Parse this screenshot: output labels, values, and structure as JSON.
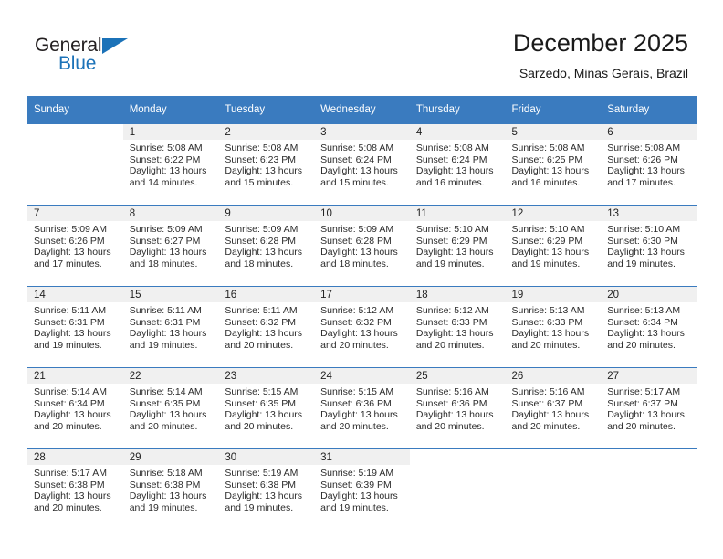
{
  "brand": {
    "line1": "General",
    "line2": "Blue",
    "triangle_icon": "triangle-icon",
    "color_dark": "#231f20",
    "color_blue": "#1b72b8"
  },
  "header": {
    "title": "December 2025",
    "subtitle": "Sarzedo, Minas Gerais, Brazil"
  },
  "theme": {
    "header_bar": "#3a7bbf",
    "day_band": "#f0f0f0",
    "text": "#2b2b2b"
  },
  "weekday_headers": [
    "Sunday",
    "Monday",
    "Tuesday",
    "Wednesday",
    "Thursday",
    "Friday",
    "Saturday"
  ],
  "weeks": [
    [
      {
        "day": "",
        "sunrise": "",
        "sunset": "",
        "daylight": "",
        "daylight2": "",
        "blank": true
      },
      {
        "day": "1",
        "sunrise": "Sunrise: 5:08 AM",
        "sunset": "Sunset: 6:22 PM",
        "daylight": "Daylight: 13 hours",
        "daylight2": "and 14 minutes."
      },
      {
        "day": "2",
        "sunrise": "Sunrise: 5:08 AM",
        "sunset": "Sunset: 6:23 PM",
        "daylight": "Daylight: 13 hours",
        "daylight2": "and 15 minutes."
      },
      {
        "day": "3",
        "sunrise": "Sunrise: 5:08 AM",
        "sunset": "Sunset: 6:24 PM",
        "daylight": "Daylight: 13 hours",
        "daylight2": "and 15 minutes."
      },
      {
        "day": "4",
        "sunrise": "Sunrise: 5:08 AM",
        "sunset": "Sunset: 6:24 PM",
        "daylight": "Daylight: 13 hours",
        "daylight2": "and 16 minutes."
      },
      {
        "day": "5",
        "sunrise": "Sunrise: 5:08 AM",
        "sunset": "Sunset: 6:25 PM",
        "daylight": "Daylight: 13 hours",
        "daylight2": "and 16 minutes."
      },
      {
        "day": "6",
        "sunrise": "Sunrise: 5:08 AM",
        "sunset": "Sunset: 6:26 PM",
        "daylight": "Daylight: 13 hours",
        "daylight2": "and 17 minutes."
      }
    ],
    [
      {
        "day": "7",
        "sunrise": "Sunrise: 5:09 AM",
        "sunset": "Sunset: 6:26 PM",
        "daylight": "Daylight: 13 hours",
        "daylight2": "and 17 minutes."
      },
      {
        "day": "8",
        "sunrise": "Sunrise: 5:09 AM",
        "sunset": "Sunset: 6:27 PM",
        "daylight": "Daylight: 13 hours",
        "daylight2": "and 18 minutes."
      },
      {
        "day": "9",
        "sunrise": "Sunrise: 5:09 AM",
        "sunset": "Sunset: 6:28 PM",
        "daylight": "Daylight: 13 hours",
        "daylight2": "and 18 minutes."
      },
      {
        "day": "10",
        "sunrise": "Sunrise: 5:09 AM",
        "sunset": "Sunset: 6:28 PM",
        "daylight": "Daylight: 13 hours",
        "daylight2": "and 18 minutes."
      },
      {
        "day": "11",
        "sunrise": "Sunrise: 5:10 AM",
        "sunset": "Sunset: 6:29 PM",
        "daylight": "Daylight: 13 hours",
        "daylight2": "and 19 minutes."
      },
      {
        "day": "12",
        "sunrise": "Sunrise: 5:10 AM",
        "sunset": "Sunset: 6:29 PM",
        "daylight": "Daylight: 13 hours",
        "daylight2": "and 19 minutes."
      },
      {
        "day": "13",
        "sunrise": "Sunrise: 5:10 AM",
        "sunset": "Sunset: 6:30 PM",
        "daylight": "Daylight: 13 hours",
        "daylight2": "and 19 minutes."
      }
    ],
    [
      {
        "day": "14",
        "sunrise": "Sunrise: 5:11 AM",
        "sunset": "Sunset: 6:31 PM",
        "daylight": "Daylight: 13 hours",
        "daylight2": "and 19 minutes."
      },
      {
        "day": "15",
        "sunrise": "Sunrise: 5:11 AM",
        "sunset": "Sunset: 6:31 PM",
        "daylight": "Daylight: 13 hours",
        "daylight2": "and 19 minutes."
      },
      {
        "day": "16",
        "sunrise": "Sunrise: 5:11 AM",
        "sunset": "Sunset: 6:32 PM",
        "daylight": "Daylight: 13 hours",
        "daylight2": "and 20 minutes."
      },
      {
        "day": "17",
        "sunrise": "Sunrise: 5:12 AM",
        "sunset": "Sunset: 6:32 PM",
        "daylight": "Daylight: 13 hours",
        "daylight2": "and 20 minutes."
      },
      {
        "day": "18",
        "sunrise": "Sunrise: 5:12 AM",
        "sunset": "Sunset: 6:33 PM",
        "daylight": "Daylight: 13 hours",
        "daylight2": "and 20 minutes."
      },
      {
        "day": "19",
        "sunrise": "Sunrise: 5:13 AM",
        "sunset": "Sunset: 6:33 PM",
        "daylight": "Daylight: 13 hours",
        "daylight2": "and 20 minutes."
      },
      {
        "day": "20",
        "sunrise": "Sunrise: 5:13 AM",
        "sunset": "Sunset: 6:34 PM",
        "daylight": "Daylight: 13 hours",
        "daylight2": "and 20 minutes."
      }
    ],
    [
      {
        "day": "21",
        "sunrise": "Sunrise: 5:14 AM",
        "sunset": "Sunset: 6:34 PM",
        "daylight": "Daylight: 13 hours",
        "daylight2": "and 20 minutes."
      },
      {
        "day": "22",
        "sunrise": "Sunrise: 5:14 AM",
        "sunset": "Sunset: 6:35 PM",
        "daylight": "Daylight: 13 hours",
        "daylight2": "and 20 minutes."
      },
      {
        "day": "23",
        "sunrise": "Sunrise: 5:15 AM",
        "sunset": "Sunset: 6:35 PM",
        "daylight": "Daylight: 13 hours",
        "daylight2": "and 20 minutes."
      },
      {
        "day": "24",
        "sunrise": "Sunrise: 5:15 AM",
        "sunset": "Sunset: 6:36 PM",
        "daylight": "Daylight: 13 hours",
        "daylight2": "and 20 minutes."
      },
      {
        "day": "25",
        "sunrise": "Sunrise: 5:16 AM",
        "sunset": "Sunset: 6:36 PM",
        "daylight": "Daylight: 13 hours",
        "daylight2": "and 20 minutes."
      },
      {
        "day": "26",
        "sunrise": "Sunrise: 5:16 AM",
        "sunset": "Sunset: 6:37 PM",
        "daylight": "Daylight: 13 hours",
        "daylight2": "and 20 minutes."
      },
      {
        "day": "27",
        "sunrise": "Sunrise: 5:17 AM",
        "sunset": "Sunset: 6:37 PM",
        "daylight": "Daylight: 13 hours",
        "daylight2": "and 20 minutes."
      }
    ],
    [
      {
        "day": "28",
        "sunrise": "Sunrise: 5:17 AM",
        "sunset": "Sunset: 6:38 PM",
        "daylight": "Daylight: 13 hours",
        "daylight2": "and 20 minutes."
      },
      {
        "day": "29",
        "sunrise": "Sunrise: 5:18 AM",
        "sunset": "Sunset: 6:38 PM",
        "daylight": "Daylight: 13 hours",
        "daylight2": "and 19 minutes."
      },
      {
        "day": "30",
        "sunrise": "Sunrise: 5:19 AM",
        "sunset": "Sunset: 6:38 PM",
        "daylight": "Daylight: 13 hours",
        "daylight2": "and 19 minutes."
      },
      {
        "day": "31",
        "sunrise": "Sunrise: 5:19 AM",
        "sunset": "Sunset: 6:39 PM",
        "daylight": "Daylight: 13 hours",
        "daylight2": "and 19 minutes."
      },
      {
        "day": "",
        "sunrise": "",
        "sunset": "",
        "daylight": "",
        "daylight2": "",
        "blank": true
      },
      {
        "day": "",
        "sunrise": "",
        "sunset": "",
        "daylight": "",
        "daylight2": "",
        "blank": true
      },
      {
        "day": "",
        "sunrise": "",
        "sunset": "",
        "daylight": "",
        "daylight2": "",
        "blank": true
      }
    ]
  ]
}
